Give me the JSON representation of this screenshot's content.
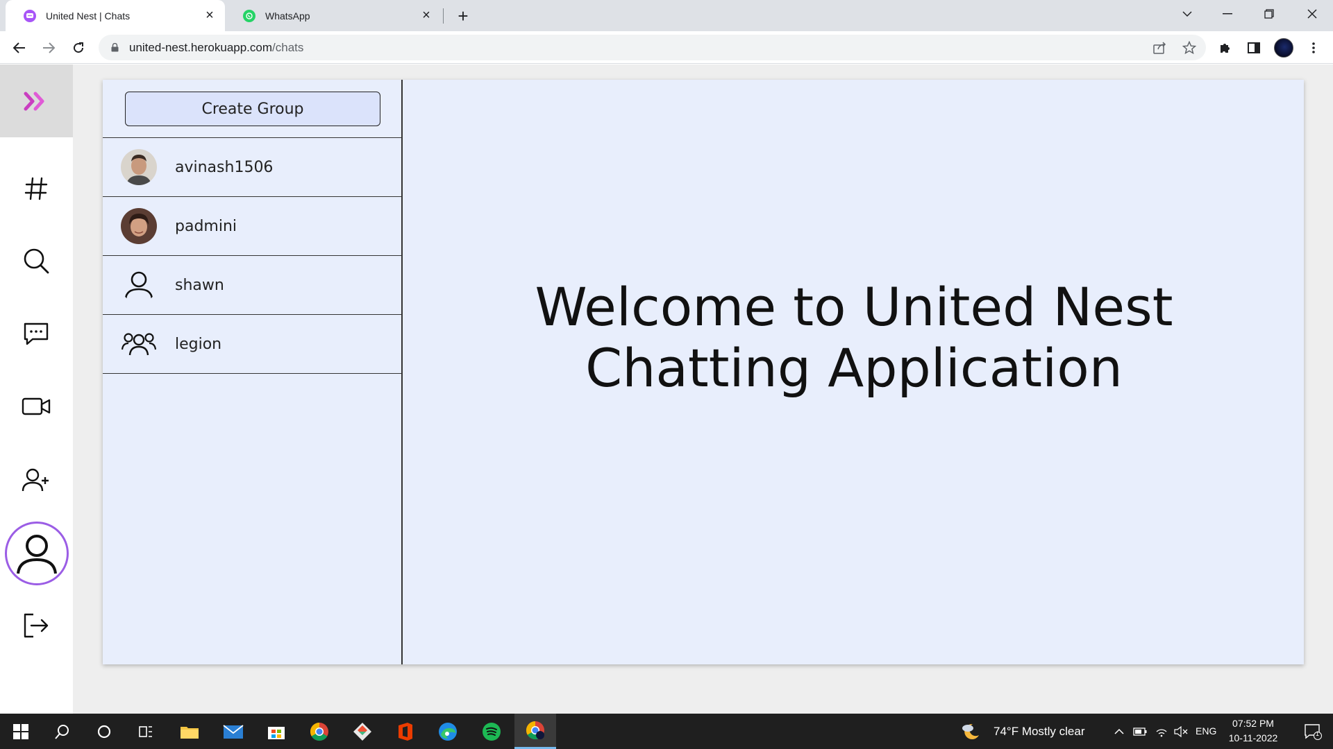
{
  "browser": {
    "tabs": [
      {
        "title": "United Nest | Chats",
        "active": true
      },
      {
        "title": "WhatsApp",
        "active": false
      }
    ],
    "url_host": "united-nest.herokuapp.com",
    "url_path": "/chats"
  },
  "sidebar": {
    "items": [
      {
        "icon": "channels-hash-icon"
      },
      {
        "icon": "search-icon"
      },
      {
        "icon": "chat-icon"
      },
      {
        "icon": "video-icon"
      },
      {
        "icon": "add-user-icon"
      },
      {
        "icon": "profile-icon"
      },
      {
        "icon": "logout-icon"
      }
    ]
  },
  "chatlist": {
    "create_group_label": "Create Group",
    "chats": [
      {
        "name": "avinash1506",
        "avatar": "photo"
      },
      {
        "name": "padmini",
        "avatar": "photo"
      },
      {
        "name": "shawn",
        "avatar": "user-icon"
      },
      {
        "name": "legion",
        "avatar": "group-icon"
      }
    ]
  },
  "main": {
    "welcome": "Welcome to United Nest Chatting Application"
  },
  "taskbar": {
    "weather": "74°F  Mostly clear",
    "lang": "ENG",
    "time": "07:52 PM",
    "date": "10-11-2022",
    "notification_count": "1"
  },
  "colors": {
    "accent": "#9b5de5",
    "panel": "#e8eefc",
    "logo": "#d63fc7"
  }
}
